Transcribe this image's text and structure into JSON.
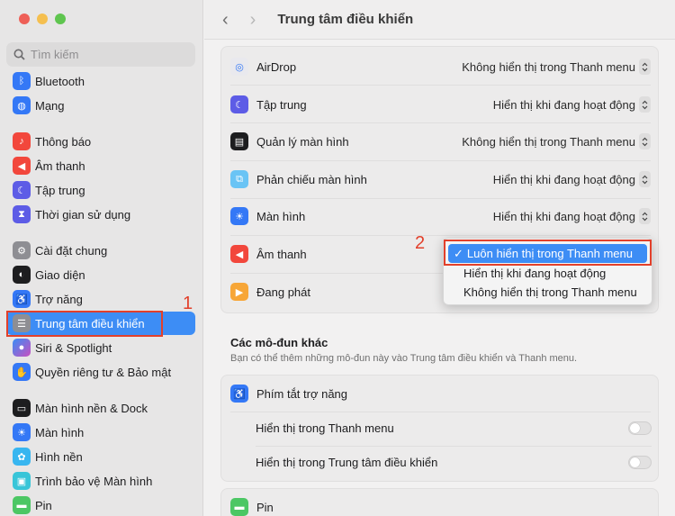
{
  "window": {
    "title": "Trung tâm điều khiển",
    "traffic_colors": [
      "#ee5f57",
      "#f5bf4f",
      "#5fc54f"
    ]
  },
  "search": {
    "placeholder": "Tìm kiếm"
  },
  "sidebar": {
    "items": [
      {
        "label": "Bluetooth",
        "icon": "bluetooth-icon",
        "color": "#3478f6"
      },
      {
        "label": "Mạng",
        "icon": "globe-icon",
        "color": "#3478f6"
      },
      {
        "label": "Thông báo",
        "icon": "bell-icon",
        "color": "#f2473c"
      },
      {
        "label": "Âm thanh",
        "icon": "speaker-icon",
        "color": "#f2473c"
      },
      {
        "label": "Tập trung",
        "icon": "moon-icon",
        "color": "#5d5ce6"
      },
      {
        "label": "Thời gian sử dụng",
        "icon": "hourglass-icon",
        "color": "#5d5ce6"
      },
      {
        "label": "Cài đặt chung",
        "icon": "gear-icon",
        "color": "#8e8e93"
      },
      {
        "label": "Giao diện",
        "icon": "appearance-icon",
        "color": "#1d1d1f"
      },
      {
        "label": "Trợ năng",
        "icon": "accessibility-icon",
        "color": "#3478f6"
      },
      {
        "label": "Trung tâm điều khiển",
        "icon": "control-center-icon",
        "color": "#8e8e93",
        "selected": true
      },
      {
        "label": "Siri & Spotlight",
        "icon": "siri-icon",
        "color": "#c850c0"
      },
      {
        "label": "Quyền riêng tư & Bảo mật",
        "icon": "hand-icon",
        "color": "#3478f6"
      },
      {
        "label": "Màn hình nền & Dock",
        "icon": "dock-icon",
        "color": "#1d1d1f"
      },
      {
        "label": "Màn hình",
        "icon": "sun-icon",
        "color": "#3478f6"
      },
      {
        "label": "Hình nền",
        "icon": "wallpaper-icon",
        "color": "#38b6f0"
      },
      {
        "label": "Trình bảo vệ Màn hình",
        "icon": "screensaver-icon",
        "color": "#38c5d8"
      },
      {
        "label": "Pin",
        "icon": "battery-icon",
        "color": "#4cc764"
      }
    ]
  },
  "annotations": {
    "step1": "1",
    "step2": "2"
  },
  "modules": [
    {
      "label": "AirDrop",
      "value": "Không hiển thị trong Thanh menu",
      "icon": "airdrop-icon",
      "color": "#e9e9ee"
    },
    {
      "label": "Tập trung",
      "value": "Hiển thị khi đang hoạt động",
      "icon": "moon-icon",
      "color": "#5d5ce6"
    },
    {
      "label": "Quản lý màn hình",
      "value": "Không hiển thị trong Thanh menu",
      "icon": "stage-manager-icon",
      "color": "#1d1d1f"
    },
    {
      "label": "Phản chiếu màn hình",
      "value": "Hiển thị khi đang hoạt động",
      "icon": "screen-mirroring-icon",
      "color": "#6ac4f5"
    },
    {
      "label": "Màn hình",
      "value": "Hiển thị khi đang hoạt động",
      "icon": "sun-icon",
      "color": "#3478f6"
    },
    {
      "label": "Âm thanh",
      "value": "",
      "icon": "speaker-icon",
      "color": "#f2473c"
    },
    {
      "label": "Đang phát",
      "value": "",
      "icon": "play-icon",
      "color": "#f7a637"
    }
  ],
  "dropdown": {
    "options": [
      "Luôn hiển thị trong Thanh menu",
      "Hiển thị khi đang hoạt động",
      "Không hiển thị trong Thanh menu"
    ],
    "selected_mark": "✓"
  },
  "other_modules": {
    "title": "Các mô-đun khác",
    "subtitle": "Bạn có thể thêm những mô-đun này vào Trung tâm điều khiển và Thanh menu.",
    "accessibility": {
      "label": "Phím tắt trợ năng",
      "show_menu_bar": "Hiển thị trong Thanh menu",
      "show_control_center": "Hiển thị trong Trung tâm điều khiển"
    },
    "battery": {
      "label": "Pin"
    }
  }
}
